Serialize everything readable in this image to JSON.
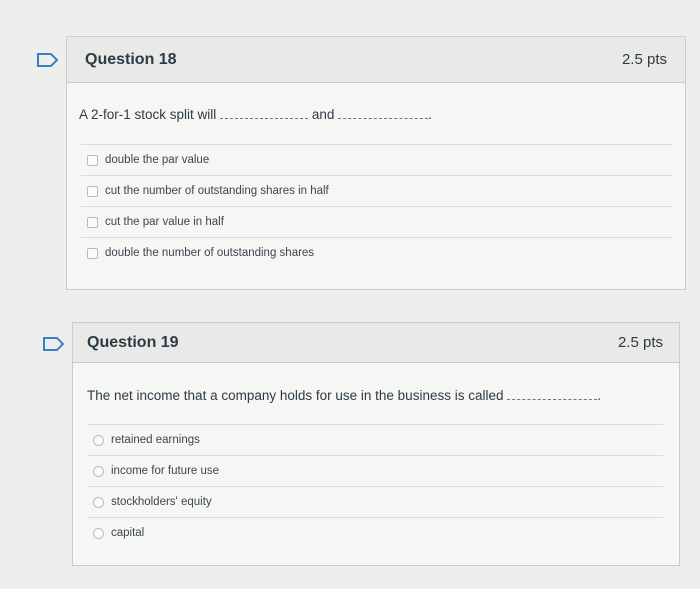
{
  "questions": [
    {
      "title": "Question 18",
      "points": "2.5 pts",
      "text_before": "A 2-for-1 stock split will",
      "text_middle": "and",
      "text_after": ".",
      "answers": [
        "double the par value",
        "cut the number of outstanding shares in half",
        "cut the par value in half",
        "double the number of outstanding shares"
      ]
    },
    {
      "title": "Question 19",
      "points": "2.5 pts",
      "text_before": "The net income that a company holds for use in the business is called",
      "text_after": ".",
      "answers": [
        "retained earnings",
        "income for future use",
        "stockholders' equity",
        "capital"
      ]
    }
  ],
  "colors": {
    "flag": "#3b7fc4",
    "header_bg": "#e9e9e7",
    "border": "#c7cdd1"
  }
}
